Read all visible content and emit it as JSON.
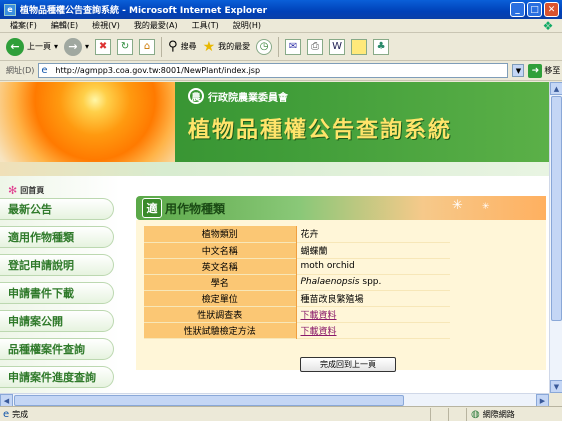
{
  "window": {
    "title": "植物品種權公告查詢系統 - Microsoft Internet Explorer"
  },
  "menu": [
    "檔案(F)",
    "編輯(E)",
    "檢視(V)",
    "我的最愛(A)",
    "工具(T)",
    "說明(H)"
  ],
  "toolbar": {
    "back_label": "上一頁",
    "search_label": "搜尋",
    "favorites_label": "我的最愛"
  },
  "address": {
    "label": "網址(D)",
    "url": "http://agmpp3.coa.gov.tw:8001/NewPlant/index.jsp",
    "go_label": "移至"
  },
  "header": {
    "org": "行政院農業委員會",
    "site_title": "植物品種權公告查詢系統"
  },
  "sidebar": {
    "home": "回首頁",
    "items": [
      "最新公告",
      "適用作物種類",
      "登記申請說明",
      "申請書件下載",
      "申請案公開",
      "品種權案件查詢",
      "申請案件進度查詢"
    ]
  },
  "section": {
    "tag": "適",
    "title": "用作物種類"
  },
  "details": [
    {
      "key": "植物類別",
      "value": "花卉"
    },
    {
      "key": "中文名稱",
      "value": "蝴蝶蘭"
    },
    {
      "key": "英文名稱",
      "value": "moth orchid"
    },
    {
      "key": "學名",
      "value": "Phalaenopsis",
      "suffix": " spp."
    },
    {
      "key": "檢定單位",
      "value": "種苗改良繁殖場"
    },
    {
      "key": "性狀調查表",
      "value": "下載資料"
    },
    {
      "key": "性狀試驗檢定方法",
      "value": "下載資料"
    }
  ],
  "back_button": "完成回到上一頁",
  "status": {
    "text": "完成",
    "zone": "網際網路"
  },
  "colors": {
    "accent_green": "#3f9c38",
    "table_key": "#fbc774",
    "link": "#8a1a6a"
  }
}
